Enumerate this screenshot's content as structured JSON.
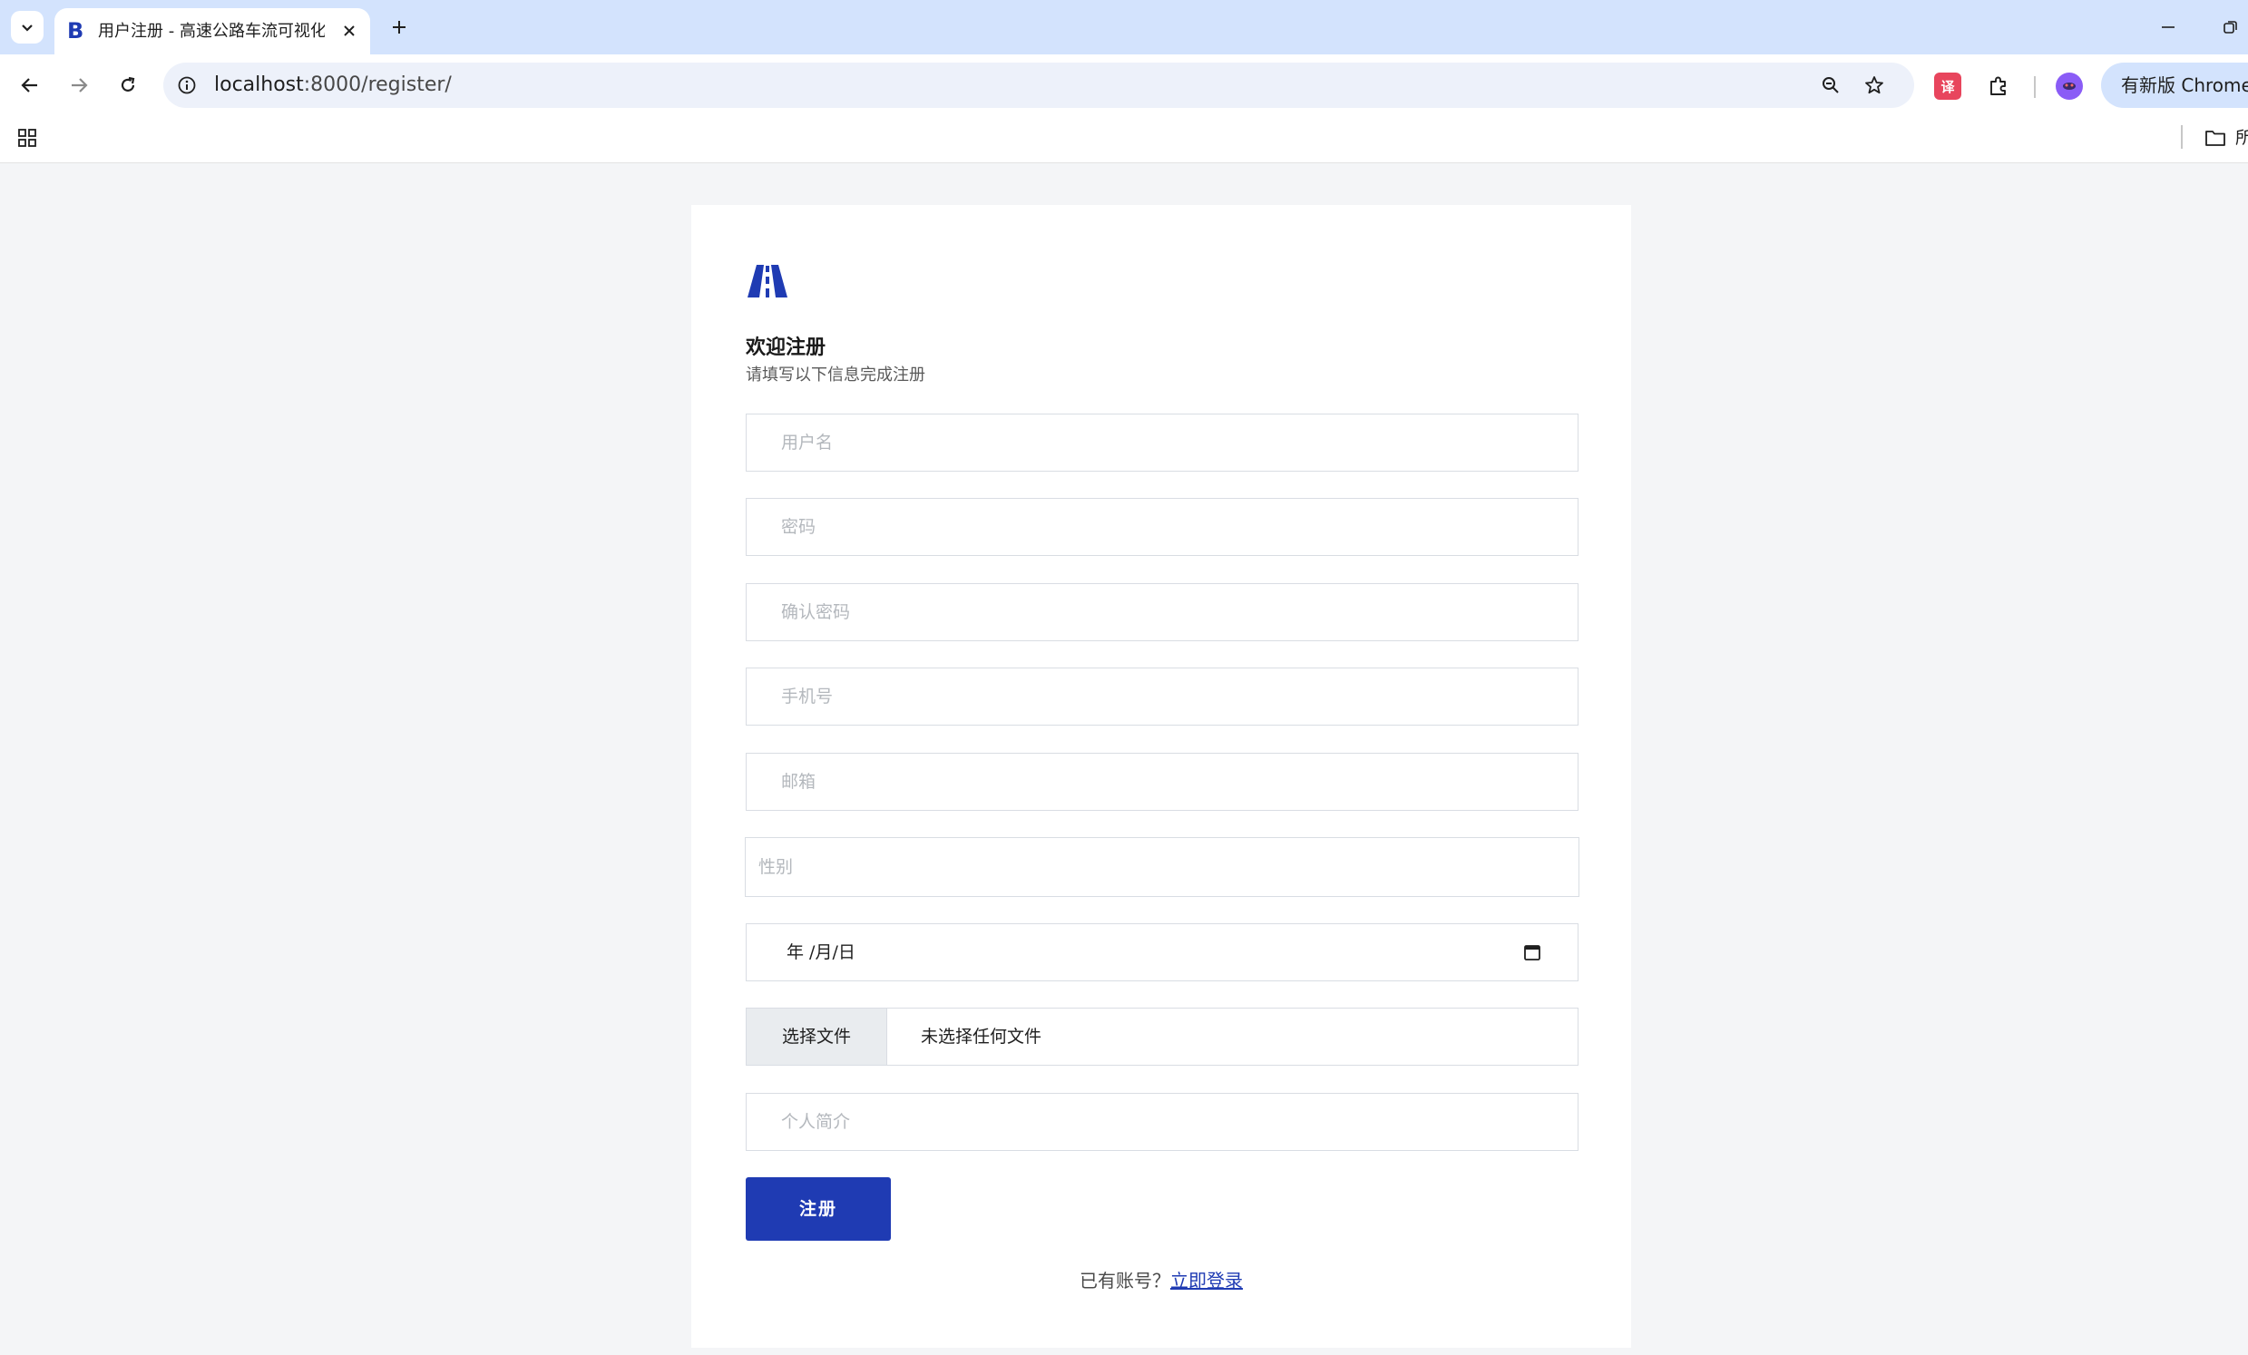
{
  "browser": {
    "tab": {
      "title": "用户注册 - 高速公路车流可视化",
      "favicon_letter": "B"
    },
    "address_bar": {
      "host": "localhost",
      "path": ":8000/register/"
    },
    "update_button_label": "有新版 Chrome 可用",
    "bookmark_folder_label": "所有书签",
    "icons": [
      "tab-search-icon",
      "close-icon",
      "plus-icon",
      "minimize-icon",
      "restore-icon",
      "back-arrow-icon",
      "forward-arrow-icon",
      "reload-icon",
      "site-info-icon",
      "zoom-icon",
      "bookmark-star-icon",
      "translate-extension-icon",
      "puzzle-extension-icon",
      "profile-avatar-icon",
      "apps-grid-icon",
      "folder-icon"
    ]
  },
  "colors": {
    "brand": "#1f3bb3",
    "page_bg": "#f4f5f7",
    "tabstrip_bg": "#d3e3fd"
  },
  "register": {
    "title": "欢迎注册",
    "subtitle": "请填写以下信息完成注册",
    "fields": {
      "username_placeholder": "用户名",
      "password_placeholder": "密码",
      "confirm_password_placeholder": "确认密码",
      "phone_placeholder": "手机号",
      "email_placeholder": "邮箱",
      "gender_placeholder": "性别",
      "birthday_value": "年 /月/日",
      "file_button_label": "选择文件",
      "file_status": "未选择任何文件",
      "bio_placeholder": "个人简介"
    },
    "submit_label": "注册",
    "login_prompt": "已有账号？",
    "login_link": "立即登录"
  }
}
